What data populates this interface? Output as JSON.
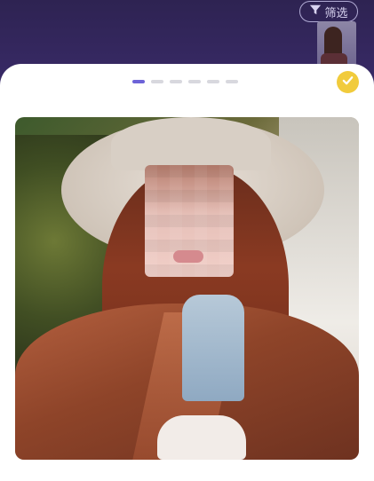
{
  "header": {
    "filter_label": "筛选",
    "filter_icon": "funnel-icon"
  },
  "card": {
    "pager": {
      "total": 6,
      "active_index": 0
    },
    "confirm_icon": "check-icon"
  },
  "colors": {
    "header_bg": "#34275e",
    "accent": "#6d63d8",
    "confirm_bg": "#f1cb3c",
    "dot_inactive": "#d8d8de"
  }
}
